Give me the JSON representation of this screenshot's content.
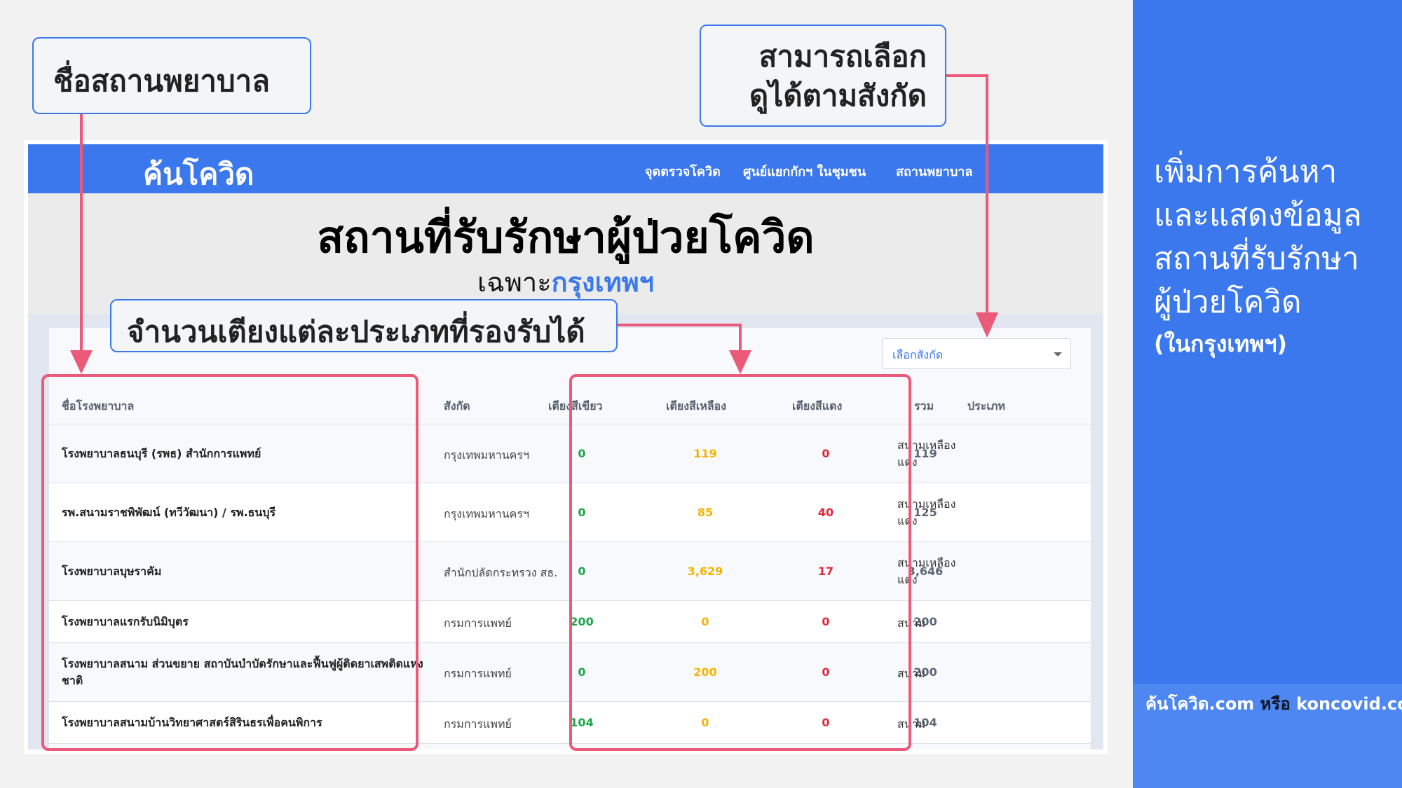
{
  "side_panel": {
    "lines": [
      "เพิ่มการค้นหา",
      "และแสดงข้อมูล",
      "สถานที่รับรักษา",
      "ผู้ป่วยโควิด"
    ],
    "sub": "(ในกรุงเทพฯ)",
    "footer_site_thai": "ค้นโควิด.com",
    "footer_or": "หรือ",
    "footer_site_en": "koncovid.com",
    "bg_color": "#3b78ee"
  },
  "site": {
    "brand": "ค้นโควิด",
    "nav": [
      "จุดตรวจโควิด",
      "ศูนย์แยกกักฯ ในชุมชน",
      "สถานพยาบาล"
    ],
    "hero_title": "สถานที่รับรักษาผู้ป่วยโควิด",
    "hero_sub_prefix": "เฉพาะ",
    "hero_sub_city": "กรุงเทพฯ",
    "filter": {
      "selected": "เลือกสังกัด"
    },
    "table": {
      "headers": [
        "ชื่อโรงพยาบาล",
        "สังกัด",
        "เตียงสีเขียว",
        "เตียงสีเหลือง",
        "เตียงสีแดง",
        "รวม",
        "ประเภท"
      ],
      "rows": [
        {
          "name": "โรงพยาบาลธนบุรี (รพธ) สำนักการแพทย์",
          "affiliation": "กรุงเทพมหานครฯ",
          "green": "0",
          "yellow": "119",
          "red": "0",
          "total": "119",
          "type_1": "สนามเหลือง",
          "type_2": "แดง"
        },
        {
          "name": "รพ.สนามราชพิพัฒน์ (ทวีวัฒนา) / รพ.ธนบุรี",
          "affiliation": "กรุงเทพมหานครฯ",
          "green": "0",
          "yellow": "85",
          "red": "40",
          "total": "125",
          "type_1": "สนามเหลือง",
          "type_2": "แดง"
        },
        {
          "name": "โรงพยาบาลบุษราคัม",
          "affiliation": "สำนักปลัดกระทรวง สธ.",
          "green": "0",
          "yellow": "3,629",
          "red": "17",
          "total": "3,646",
          "type_1": "สนามเหลือง",
          "type_2": "แดง"
        },
        {
          "name": "โรงพยาบาลแรกรับนิมิบุตร",
          "affiliation": "กรมการแพทย์",
          "green": "200",
          "yellow": "0",
          "red": "0",
          "total": "200",
          "type": "สนาม"
        },
        {
          "name": "โรงพยาบาลสนาม ส่วนขยาย สถาบันบำบัดรักษาและฟื้นฟูผู้ติดยาเสพติดแห่งชาติ",
          "affiliation": "กรมการแพทย์",
          "green": "0",
          "yellow": "200",
          "red": "0",
          "total": "200",
          "type": "สนาม"
        },
        {
          "name": "โรงพยาบาลสนามบ้านวิทยาศาสตร์สิรินธรเพื่อคนพิการ",
          "affiliation": "กรมการแพทย์",
          "green": "104",
          "yellow": "0",
          "red": "0",
          "total": "104",
          "type": "สนาม"
        }
      ]
    }
  },
  "callouts": {
    "hospital_name": "ชื่อสถานพยาบาล",
    "filter_line1": "สามารถเลือก",
    "filter_line2": "ดูได้ตามสังกัด",
    "beds": "จำนวนเตียงแต่ละประเภทที่รองรับได้"
  },
  "colors": {
    "accent_blue": "#3b78ee",
    "highlight_pink": "#ec5a7a",
    "green_bed": "#1fa44a",
    "yellow_bed": "#f5b400",
    "red_bed": "#e0283a"
  }
}
